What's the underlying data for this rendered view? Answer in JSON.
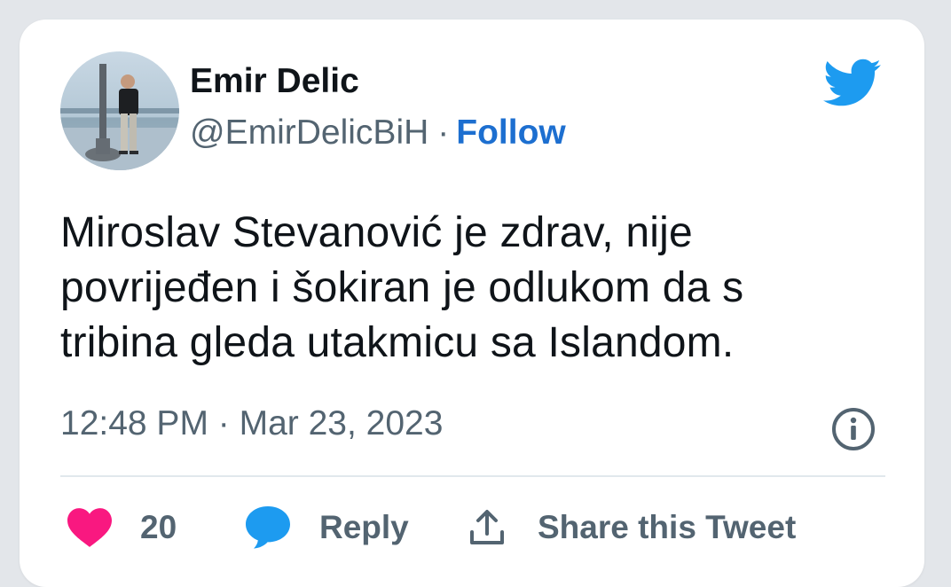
{
  "author": {
    "name": "Emir Delic",
    "handle": "@EmirDelicBiH",
    "separator": "·",
    "follow_label": "Follow"
  },
  "tweet": {
    "lines": [
      "Miroslav Stevanović je zdrav, nije",
      "povrijeđen i šokiran je odlukom da s",
      "tribina gleda utakmicu sa Islandom."
    ],
    "timestamp": "12:48 PM · Mar 23, 2023"
  },
  "actions": {
    "like_count": "20",
    "reply_label": "Reply",
    "share_label": "Share this Tweet"
  },
  "icons": {
    "brand": "twitter-bird-icon",
    "info": "info-icon",
    "like": "heart-icon",
    "reply": "speech-bubble-icon",
    "share": "share-upload-icon"
  },
  "colors": {
    "brand_blue": "#1d9bf0",
    "follow_blue": "#1d6fd0",
    "like_pink": "#f91880",
    "text_primary": "#0f1419",
    "text_secondary": "#536471",
    "background": "#e3e6ea",
    "card": "#ffffff"
  }
}
